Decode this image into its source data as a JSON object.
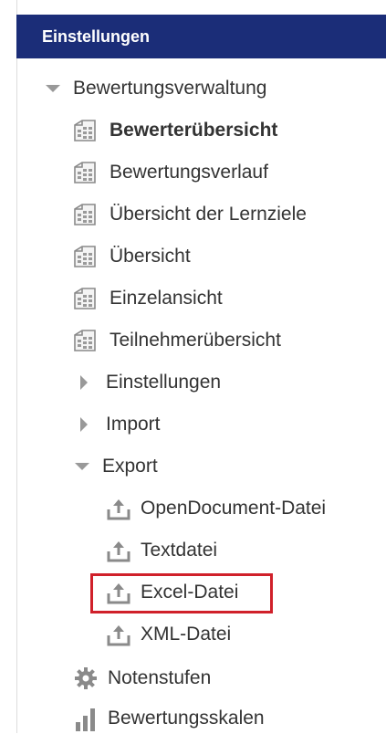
{
  "header": {
    "title": "Einstellungen"
  },
  "tree": {
    "root": {
      "label": "Bewertungsverwaltung",
      "expanded": true
    },
    "views": [
      {
        "label": "Bewerterübersicht",
        "active": true,
        "icon": "report-table-icon"
      },
      {
        "label": "Bewertungsverlauf",
        "icon": "report-table-icon"
      },
      {
        "label": "Übersicht der Lernziele",
        "icon": "report-table-icon"
      },
      {
        "label": "Übersicht",
        "icon": "report-table-icon"
      },
      {
        "label": "Einzelansicht",
        "icon": "report-table-icon"
      },
      {
        "label": "Teilnehmerübersicht",
        "icon": "report-table-icon"
      }
    ],
    "settings": {
      "label": "Einstellungen",
      "expanded": false
    },
    "import": {
      "label": "Import",
      "expanded": false
    },
    "export": {
      "label": "Export",
      "expanded": true,
      "items": [
        {
          "label": "OpenDocument-Datei",
          "icon": "upload-icon"
        },
        {
          "label": "Textdatei",
          "icon": "upload-icon"
        },
        {
          "label": "Excel-Datei",
          "icon": "upload-icon",
          "highlighted": true
        },
        {
          "label": "XML-Datei",
          "icon": "upload-icon"
        }
      ]
    },
    "grade_levels": {
      "label": "Notenstufen",
      "icon": "gear-icon"
    },
    "scales": {
      "label": "Bewertungsskalen",
      "icon": "bar-chart-icon"
    }
  },
  "colors": {
    "header_bg": "#1b2d78",
    "highlight_border": "#d0202a",
    "triangle": "#999999",
    "text": "#333333"
  }
}
